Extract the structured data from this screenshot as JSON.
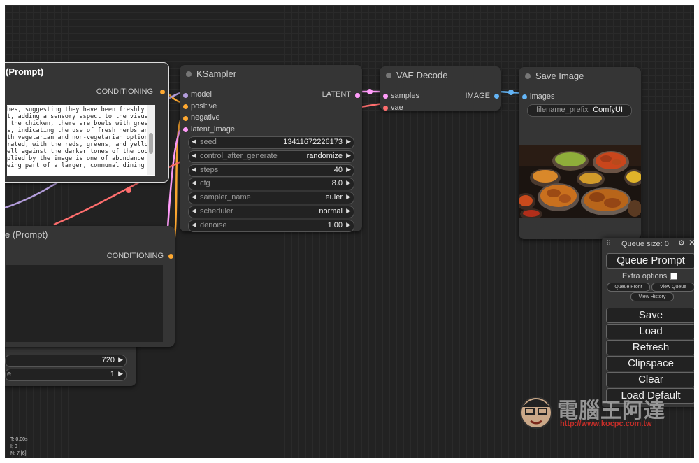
{
  "prompt_node_1": {
    "title": "(Prompt)",
    "output": "CONDITIONING",
    "text": "hes, suggesting they have been freshly\nt, adding a sensory aspect to the visual\n the chicken, there are bowls with green\ns, indicating the use of fresh herbs and\nth vegetarian and non-vegetarian options. The\nrated, with the reds, greens, and yellows of\nell against the darker tones of the cookware.\nplied by the image is one of abundance and\neing part of a larger, communal dining"
  },
  "prompt_node_2": {
    "title": "e (Prompt)",
    "output": "CONDITIONING"
  },
  "latent_node": {
    "w_height": "720",
    "w_batch_label": "e",
    "w_batch": "1"
  },
  "ksampler": {
    "title": "KSampler",
    "inputs": [
      "model",
      "positive",
      "negative",
      "latent_image"
    ],
    "output": "LATENT",
    "widgets": [
      {
        "label": "seed",
        "value": "13411672226173"
      },
      {
        "label": "control_after_generate",
        "value": "randomize"
      },
      {
        "label": "steps",
        "value": "40"
      },
      {
        "label": "cfg",
        "value": "8.0"
      },
      {
        "label": "sampler_name",
        "value": "euler"
      },
      {
        "label": "scheduler",
        "value": "normal"
      },
      {
        "label": "denoise",
        "value": "1.00"
      }
    ]
  },
  "vae_decode": {
    "title": "VAE Decode",
    "inputs": [
      "samples",
      "vae"
    ],
    "output": "IMAGE"
  },
  "save_image": {
    "title": "Save Image",
    "input": "images",
    "widget_label": "filename_prefix",
    "widget_value": "ComfyUI"
  },
  "queue_menu": {
    "queue_size": "Queue size: 0",
    "queue_prompt": "Queue Prompt",
    "extra_options": "Extra options",
    "queue_front": "Queue Front",
    "view_queue": "View Queue",
    "view_history": "View History",
    "save": "Save",
    "load": "Load",
    "refresh": "Refresh",
    "clipspace": "Clipspace",
    "clear": "Clear",
    "load_default": "Load Default"
  },
  "stats": {
    "t": "T: 0.00s",
    "i": "I: 0",
    "n": "N: 7 [6]"
  },
  "watermark": {
    "site_name": "電腦王阿達",
    "url": "http://www.kocpc.com.tw"
  },
  "colors": {
    "model": "#b39ddb",
    "conditioning": "#ffa931",
    "latent": "#ff9cf9",
    "vae": "#ff6e6e",
    "image": "#64b5f6"
  }
}
